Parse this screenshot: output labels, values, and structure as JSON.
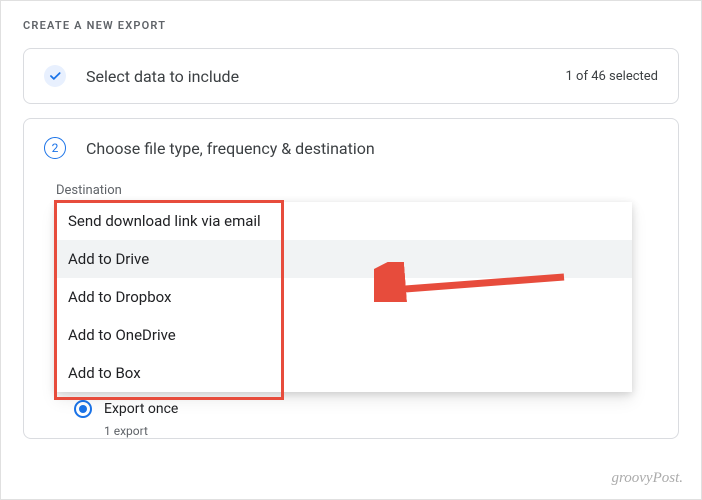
{
  "page_title": "CREATE A NEW EXPORT",
  "step1": {
    "title": "Select data to include",
    "selection": "1 of 46 selected"
  },
  "step2": {
    "number": "2",
    "title": "Choose file type, frequency & destination",
    "destination_label": "Destination",
    "options": {
      "o0": "Send download link via email",
      "o1": "Add to Drive",
      "o2": "Add to Dropbox",
      "o3": "Add to OneDrive",
      "o4": "Add to Box"
    },
    "frequency": {
      "label": "Export once",
      "sub": "1 export"
    }
  },
  "watermark": "groovyPost."
}
